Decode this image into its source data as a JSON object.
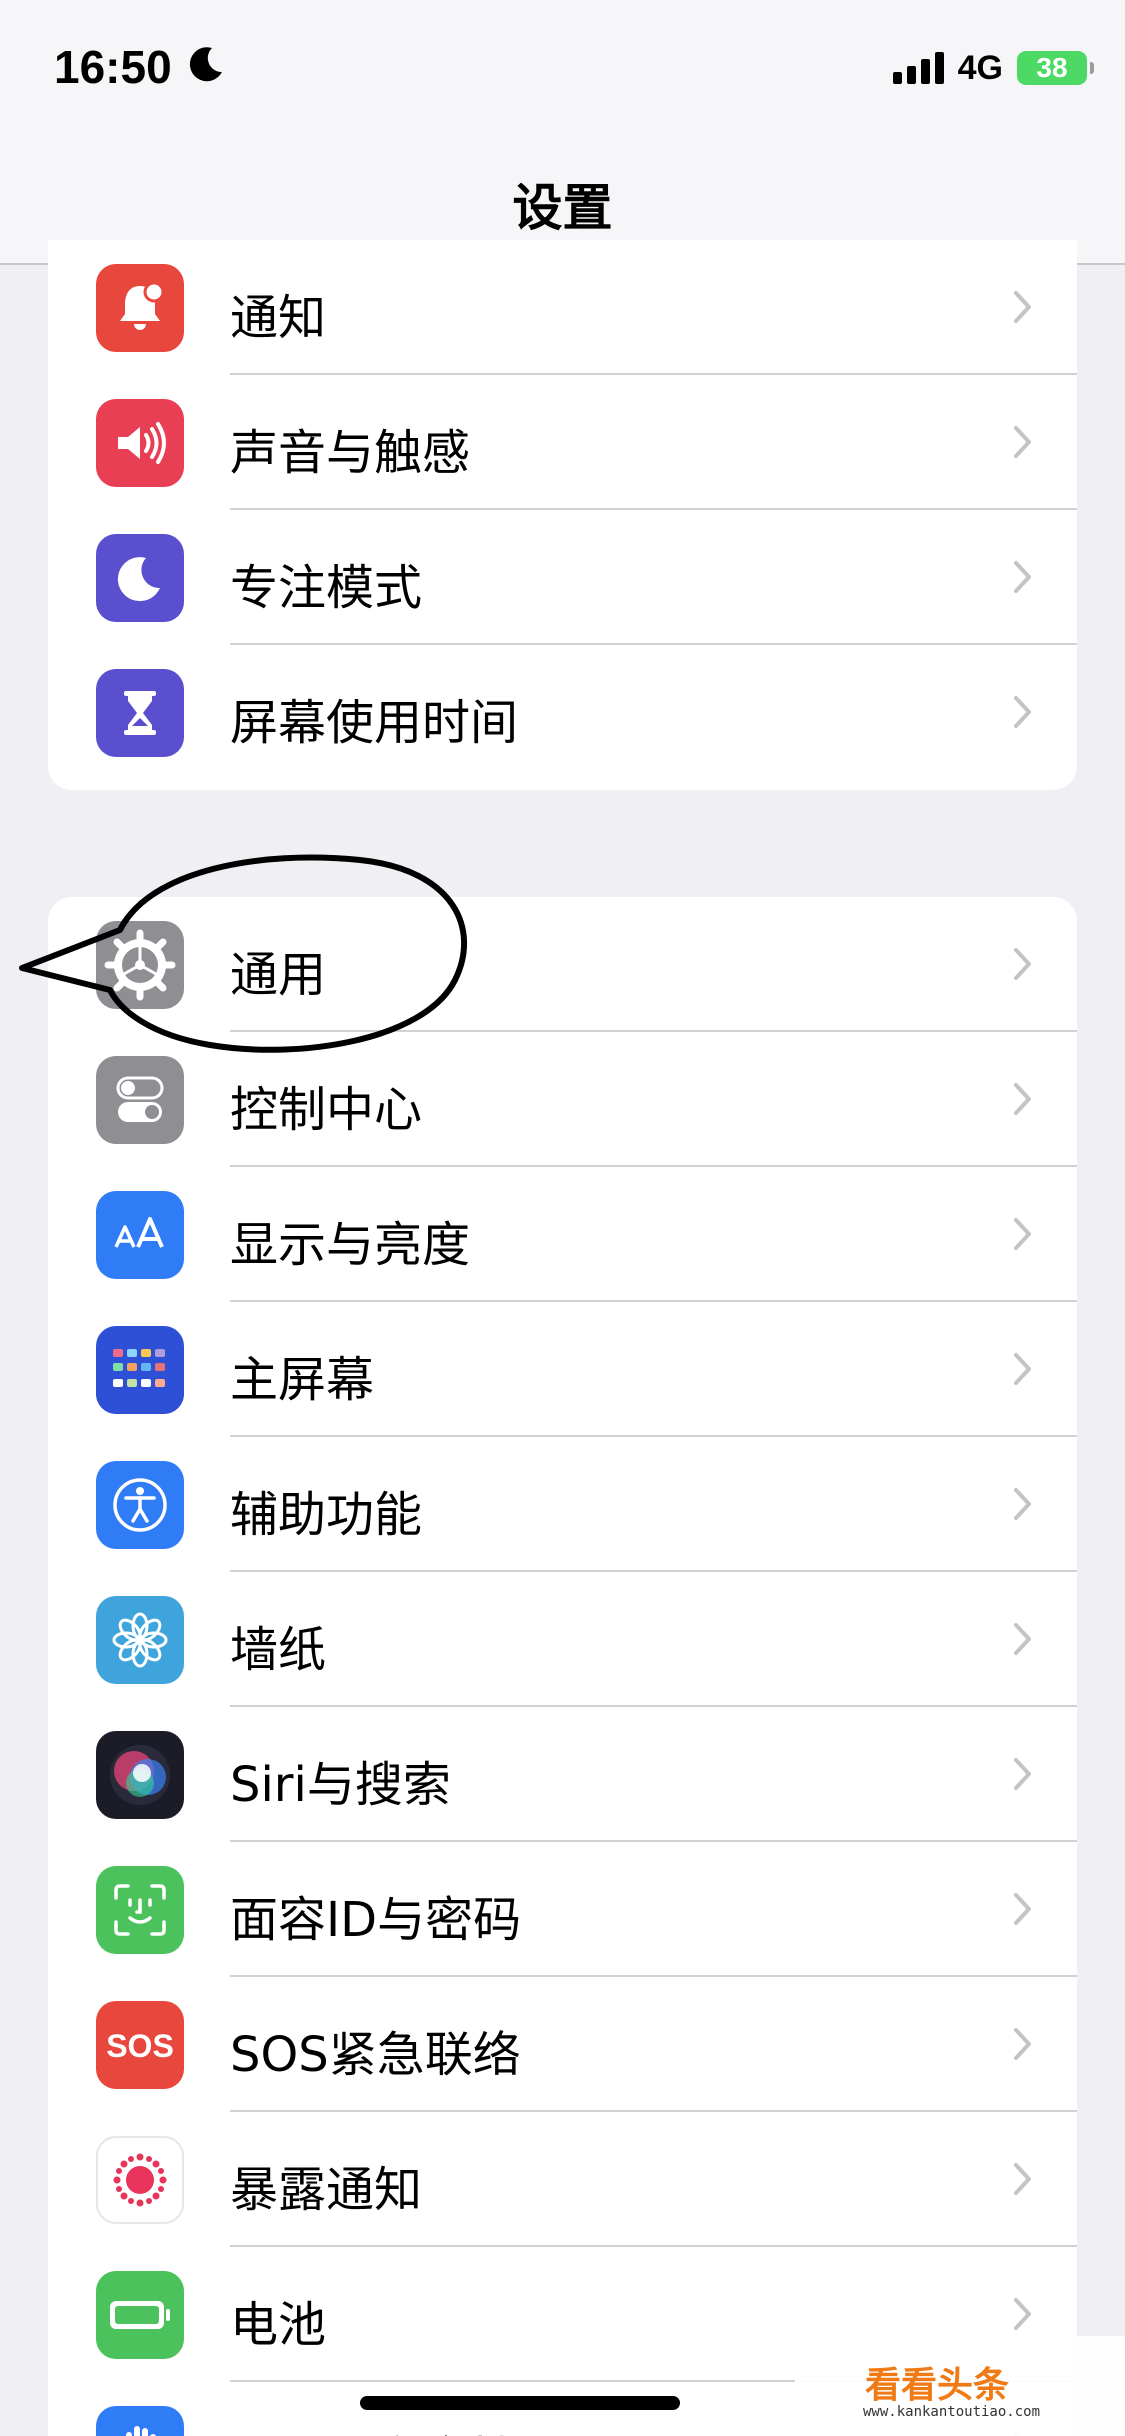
{
  "status_bar": {
    "time": "16:50",
    "network": "4G",
    "battery": "38"
  },
  "nav": {
    "title": "设置"
  },
  "annotation_note": "",
  "groups": [
    {
      "items": [
        {
          "label": "通知",
          "icon": "notification-icon",
          "color": "#e8473d"
        },
        {
          "label": "声音与触感",
          "icon": "speaker-icon",
          "color": "#e83f55"
        },
        {
          "label": "专注模式",
          "icon": "moon-icon",
          "color": "#5a4fcf"
        },
        {
          "label": "屏幕使用时间",
          "icon": "hourglass-icon",
          "color": "#5a4fcf"
        }
      ]
    },
    {
      "items": [
        {
          "label": "通用",
          "icon": "gear-icon",
          "color": "#8e8e93"
        },
        {
          "label": "控制中心",
          "icon": "toggle-icon",
          "color": "#8e8e93"
        },
        {
          "label": "显示与亮度",
          "icon": "text-size-icon",
          "color": "#2f7cf6"
        },
        {
          "label": "主屏幕",
          "icon": "home-screen-grid-icon",
          "color": "#2d50d6"
        },
        {
          "label": "辅助功能",
          "icon": "accessibility-icon",
          "color": "#2f7cf6"
        },
        {
          "label": "墙纸",
          "icon": "flower-icon",
          "color": "#3fa4dc"
        },
        {
          "label": "Siri与搜索",
          "icon": "siri-icon",
          "color": "#1c1c28"
        },
        {
          "label": "面容ID与密码",
          "icon": "face-id-icon",
          "color": "#4cc25c"
        },
        {
          "label": "SOS紧急联络",
          "icon": "sos-icon",
          "color": "#e8473d"
        },
        {
          "label": "暴露通知",
          "icon": "exposure-icon",
          "color": "#ffffff"
        },
        {
          "label": "电池",
          "icon": "battery-icon",
          "color": "#4cc25c"
        },
        {
          "label": "隐私与安全性",
          "icon": "hand-icon",
          "color": "#2f7cf6"
        }
      ]
    }
  ],
  "watermark": {
    "text": "看看头条",
    "url": "www.kankantoutiao.com"
  }
}
